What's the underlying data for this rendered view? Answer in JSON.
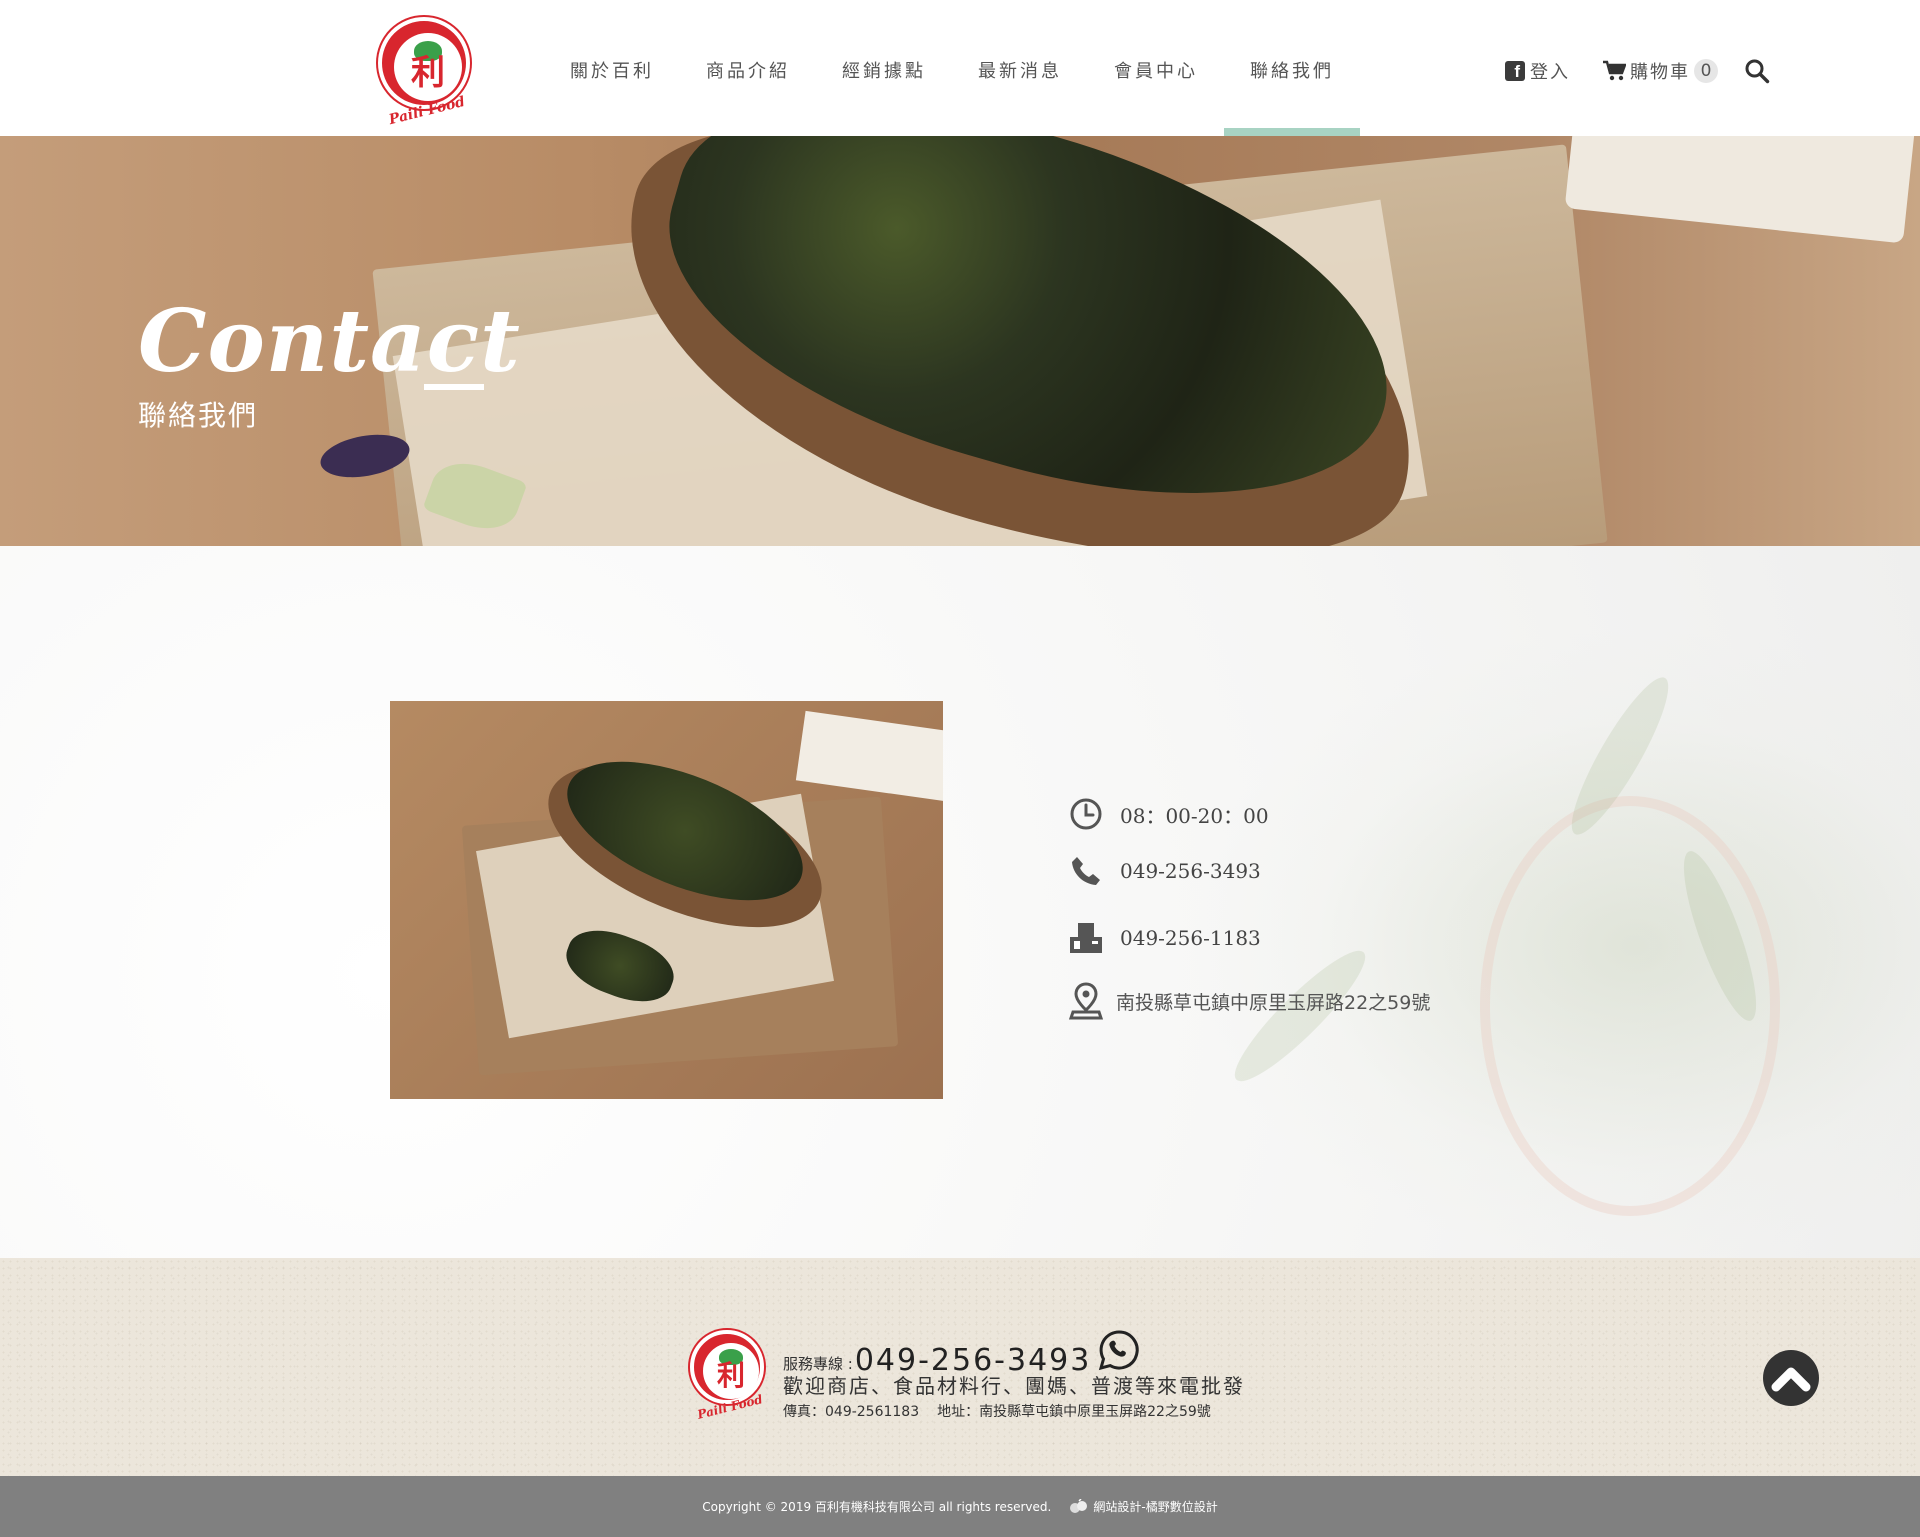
{
  "header": {
    "logo_text": "Paili Food",
    "logo_char": "利",
    "nav": [
      {
        "label": "關於百利"
      },
      {
        "label": "商品介紹"
      },
      {
        "label": "經銷據點"
      },
      {
        "label": "最新消息"
      },
      {
        "label": "會員中心"
      },
      {
        "label": "聯絡我們",
        "active": true
      }
    ],
    "login_label": "登入",
    "fb_glyph": "f",
    "cart_label": "購物車",
    "cart_count": "0",
    "icons": [
      "facebook-icon",
      "cart-icon",
      "search-icon"
    ]
  },
  "banner": {
    "title": "Contact",
    "subtitle": "聯絡我們"
  },
  "contact": {
    "hours": "08：00-20：00",
    "phone": "049-256-3493",
    "fax": "049-256-1183",
    "address": "南投縣草屯鎮中原里玉屏路22之59號"
  },
  "footer": {
    "service_label": "服務專線 :",
    "service_phone": "049-256-3493",
    "welcome": "歡迎商店、食品材料行、團媽、普渡等來電批發",
    "fax": "傳真：049-2561183",
    "address": "地址：南投縣草屯鎮中原里玉屏路22之59號",
    "copyright": "Copyright © 2019 百利有機科技有限公司 all rights reserved.",
    "designer": "網站設計-橘野數位設計"
  },
  "colors": {
    "accent_underline": "#a8d3c3",
    "brand_red": "#d8262e",
    "copyright_bar": "#808080"
  }
}
